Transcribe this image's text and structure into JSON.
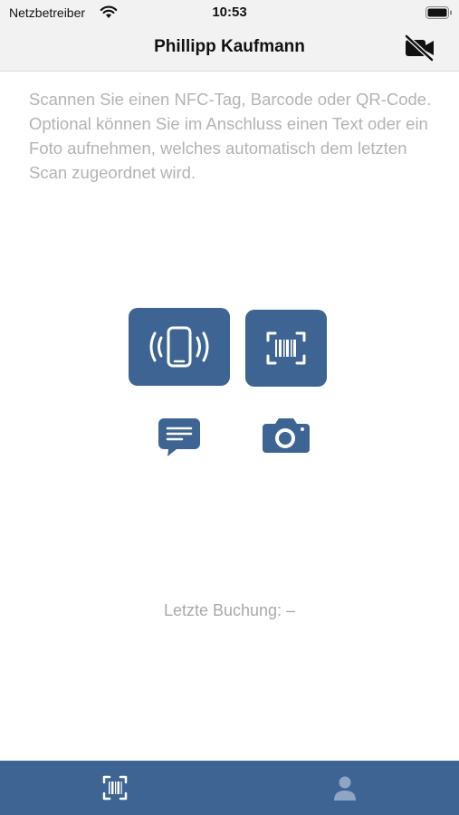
{
  "status_bar": {
    "carrier": "Netzbetreiber",
    "time": "10:53",
    "icons": [
      "wifi-icon",
      "battery-icon"
    ]
  },
  "nav": {
    "title": "Phillipp Kaufmann",
    "right_icon": "video-off-icon"
  },
  "instructions": "Scannen Sie einen NFC-Tag, Barcode oder QR-Code. Optional können Sie im Anschluss einen Text oder ein Foto aufnehmen, welches automatisch dem letzten Scan zugeordnet wird.",
  "actions": {
    "nfc_icon": "nfc-phone-icon",
    "barcode_icon": "barcode-scan-icon",
    "text_icon": "text-bubble-icon",
    "camera_icon": "camera-icon"
  },
  "last_booking": "Letzte Buchung: –",
  "tab_bar": {
    "tabs": [
      {
        "icon": "barcode-scan-icon"
      },
      {
        "icon": "person-icon"
      }
    ]
  },
  "colors": {
    "accent": "#3d6493",
    "placeholder_text": "#b3b3b3",
    "bar_background": "#f2f2f2"
  }
}
